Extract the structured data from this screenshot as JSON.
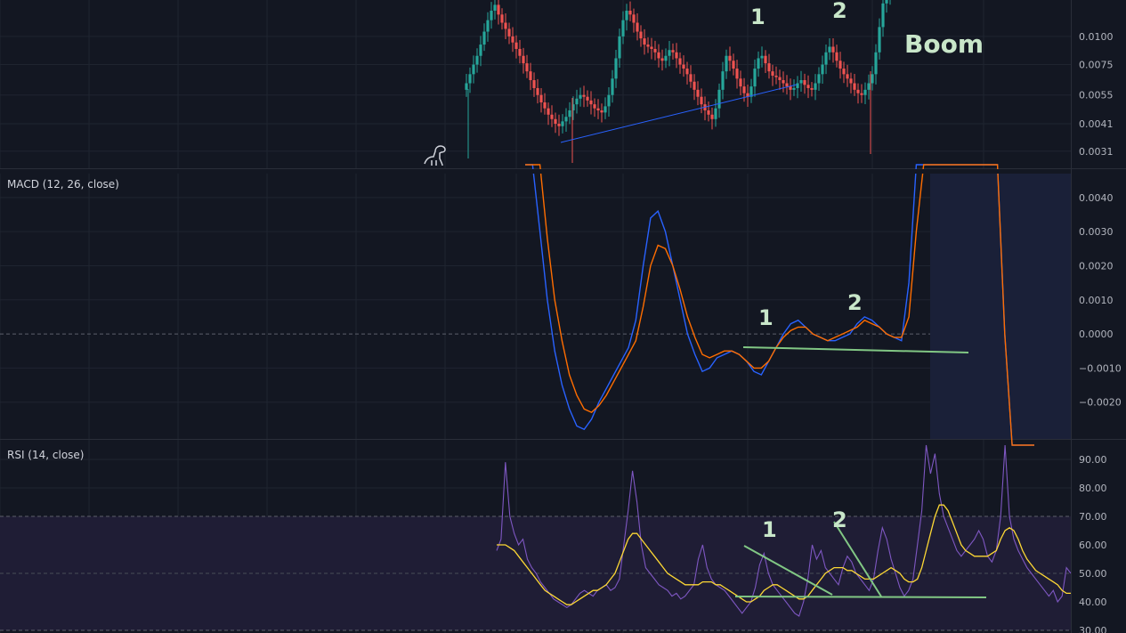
{
  "colors": {
    "background": "#131722",
    "grid": "#1f2430",
    "divider": "#2a2e39",
    "up": "#26a69a",
    "down": "#ef5350",
    "macd": "#2962ff",
    "signal": "#ff6d00",
    "rsi": "#7e57c2",
    "rsi_ma": "#fdd835",
    "trend_green": "#81c784",
    "trend_blue": "#2962ff",
    "rsi_band": "#1f1d35",
    "annotation": "#c8e6c9"
  },
  "chart_data": [
    {
      "type": "candlestick",
      "pane": "price",
      "y_ticks": [
        "0.0100",
        "0.0075",
        "0.0055",
        "0.0041",
        "0.0031"
      ],
      "y_tick_values": [
        0.01,
        0.0075,
        0.0055,
        0.0041,
        0.0031
      ],
      "y_scale": "log",
      "ylim": [
        0.0027,
        0.0145
      ],
      "x_index_range": [
        0,
        120
      ],
      "closes": [
        0.0058,
        0.0062,
        0.0068,
        0.0075,
        0.0082,
        0.0092,
        0.0105,
        0.0118,
        0.013,
        0.0138,
        0.0125,
        0.0115,
        0.0108,
        0.01,
        0.0094,
        0.0088,
        0.0082,
        0.0076,
        0.007,
        0.0064,
        0.0059,
        0.0055,
        0.0051,
        0.0048,
        0.0045,
        0.0043,
        0.0041,
        0.004,
        0.0042,
        0.0044,
        0.0047,
        0.005,
        0.0053,
        0.0055,
        0.0054,
        0.0052,
        0.005,
        0.0048,
        0.0047,
        0.0046,
        0.0049,
        0.0055,
        0.0065,
        0.008,
        0.01,
        0.0118,
        0.013,
        0.0125,
        0.0115,
        0.0105,
        0.0098,
        0.0092,
        0.009,
        0.0088,
        0.0085,
        0.008,
        0.0078,
        0.0082,
        0.0087,
        0.0085,
        0.008,
        0.0075,
        0.0072,
        0.0068,
        0.0063,
        0.0058,
        0.0054,
        0.005,
        0.0047,
        0.0045,
        0.0043,
        0.0048,
        0.0058,
        0.007,
        0.0082,
        0.0078,
        0.0072,
        0.0065,
        0.006,
        0.0056,
        0.0054,
        0.006,
        0.0072,
        0.008,
        0.0082,
        0.0076,
        0.007,
        0.0067,
        0.0066,
        0.0064,
        0.0062,
        0.006,
        0.0058,
        0.0059,
        0.0062,
        0.0064,
        0.0061,
        0.0059,
        0.0058,
        0.0062,
        0.0068,
        0.0075,
        0.0085,
        0.009,
        0.0085,
        0.0078,
        0.0072,
        0.0068,
        0.0065,
        0.0062,
        0.0058,
        0.0056,
        0.0055,
        0.0058,
        0.0062,
        0.0068,
        0.0085,
        0.011,
        0.014,
        0.015,
        0.016
      ]
    },
    {
      "type": "line",
      "pane": "macd",
      "title": "MACD (12, 26, close)",
      "y_ticks": [
        "0.0040",
        "0.0030",
        "0.0020",
        "0.0010",
        "0.0000",
        "−0.0010",
        "−0.0020"
      ],
      "y_tick_values": [
        0.004,
        0.003,
        0.002,
        0.001,
        0.0,
        -0.001,
        -0.002
      ],
      "ylim": [
        -0.003,
        0.0047
      ],
      "x_index_range": [
        0,
        150
      ],
      "series": [
        {
          "values": [
            0.01,
            0.006,
            0.003,
            0.001,
            -0.0005,
            -0.0015,
            -0.0022,
            -0.0027,
            -0.0028,
            -0.0025,
            -0.002,
            -0.0016,
            -0.0012,
            -0.0008,
            -0.0004,
            0.0004,
            0.002,
            0.0034,
            0.0036,
            0.003,
            0.002,
            0.001,
            0.0,
            -0.0006,
            -0.0011,
            -0.001,
            -0.0007,
            -0.0006,
            -0.0005,
            -0.0006,
            -0.0008,
            -0.0011,
            -0.0012,
            -0.0008,
            -0.0004,
            0.0,
            0.0003,
            0.0004,
            0.0002,
            0.0,
            -0.0001,
            -0.0002,
            -0.0002,
            -0.0001,
            0.0,
            0.0003,
            0.0005,
            0.0004,
            0.0002,
            0.0,
            -0.0001,
            -0.0002,
            0.0015,
            0.006,
            0.012,
            0.02,
            0.03,
            0.04,
            0.05,
            0.06,
            0.05,
            0.04,
            0.03,
            0.02,
            0.01,
            0.0,
            -0.01,
            -0.02,
            -0.03,
            -0.04
          ]
        },
        {
          "values": [
            0.012,
            0.008,
            0.005,
            0.0028,
            0.001,
            -0.0002,
            -0.0012,
            -0.0018,
            -0.0022,
            -0.0023,
            -0.0021,
            -0.0018,
            -0.0014,
            -0.001,
            -0.0006,
            -0.0002,
            0.0008,
            0.002,
            0.0026,
            0.0025,
            0.002,
            0.0013,
            0.0005,
            -0.0001,
            -0.0006,
            -0.0007,
            -0.0006,
            -0.0005,
            -0.0005,
            -0.0006,
            -0.0008,
            -0.001,
            -0.001,
            -0.0008,
            -0.0004,
            -0.0001,
            0.0001,
            0.0002,
            0.0002,
            0.0,
            -0.0001,
            -0.0002,
            -0.0001,
            0.0,
            0.0001,
            0.0002,
            0.0004,
            0.0003,
            0.0002,
            0.0,
            -0.0001,
            -0.0001,
            0.0005,
            0.003,
            0.008,
            0.015,
            0.025,
            0.035,
            0.045,
            0.055,
            0.048,
            0.04,
            0.03,
            0.02,
            0.01,
            0.0,
            -0.01,
            -0.02,
            -0.03,
            -0.04
          ]
        }
      ]
    },
    {
      "type": "line",
      "pane": "rsi",
      "title": "RSI (14, close)",
      "y_ticks": [
        "90.00",
        "80.00",
        "70.00",
        "60.00",
        "50.00",
        "40.00",
        "30.00"
      ],
      "y_tick_values": [
        90,
        80,
        70,
        60,
        50,
        40,
        30
      ],
      "ylim": [
        30,
        95
      ],
      "band": [
        30,
        70
      ],
      "x_index_range": [
        0,
        150
      ],
      "series": [
        {
          "values": [
            58,
            62,
            89,
            70,
            64,
            60,
            62,
            55,
            52,
            50,
            47,
            45,
            43,
            41,
            40,
            39,
            38,
            39,
            41,
            43,
            44,
            43,
            42,
            44,
            45,
            46,
            44,
            45,
            48,
            60,
            72,
            86,
            75,
            60,
            52,
            50,
            48,
            46,
            45,
            44,
            42,
            43,
            41,
            42,
            44,
            46,
            55,
            60,
            52,
            48,
            46,
            45,
            44,
            42,
            40,
            38,
            36,
            38,
            40,
            45,
            53,
            57,
            50,
            46,
            44,
            42,
            40,
            38,
            36,
            35,
            40,
            48,
            60,
            55,
            58,
            52,
            50,
            48,
            46,
            52,
            56,
            54,
            50,
            48,
            46,
            44,
            48,
            58,
            66,
            62,
            55,
            50,
            45,
            42,
            44,
            48,
            60,
            72,
            95,
            85,
            92,
            78,
            70,
            66,
            62,
            58,
            56,
            58,
            60,
            62,
            65,
            62,
            56,
            54,
            58,
            70,
            95,
            70,
            62,
            58,
            55,
            52,
            50,
            48,
            46,
            44,
            42,
            44,
            40,
            42,
            52,
            50
          ]
        },
        {
          "values": [
            60,
            60,
            60,
            59,
            58,
            56,
            54,
            52,
            50,
            48,
            46,
            44,
            43,
            42,
            41,
            40,
            39,
            39,
            40,
            41,
            42,
            43,
            44,
            44,
            45,
            46,
            48,
            50,
            54,
            58,
            62,
            64,
            64,
            62,
            60,
            58,
            56,
            54,
            52,
            50,
            49,
            48,
            47,
            46,
            46,
            46,
            46,
            47,
            47,
            47,
            46,
            46,
            45,
            44,
            43,
            42,
            41,
            40,
            40,
            41,
            42,
            44,
            45,
            46,
            46,
            45,
            44,
            43,
            42,
            41,
            41,
            42,
            44,
            46,
            48,
            50,
            51,
            52,
            52,
            52,
            51,
            51,
            50,
            49,
            48,
            48,
            48,
            49,
            50,
            51,
            52,
            51,
            50,
            48,
            47,
            47,
            48,
            52,
            58,
            64,
            70,
            74,
            74,
            72,
            68,
            64,
            60,
            58,
            57,
            56,
            56,
            56,
            56,
            57,
            58,
            62,
            65,
            66,
            65,
            62,
            58,
            55,
            53,
            51,
            50,
            49,
            48,
            47,
            46,
            44,
            43,
            43
          ]
        }
      ]
    }
  ],
  "panes": {
    "macd": {
      "title": "MACD (12, 26, close)"
    },
    "rsi": {
      "title": "RSI (14, close)"
    }
  },
  "annotations": {
    "boom": "Boom",
    "label_1": "1",
    "label_2": "2"
  },
  "icons": {
    "watermark": "dinosaur-icon"
  }
}
